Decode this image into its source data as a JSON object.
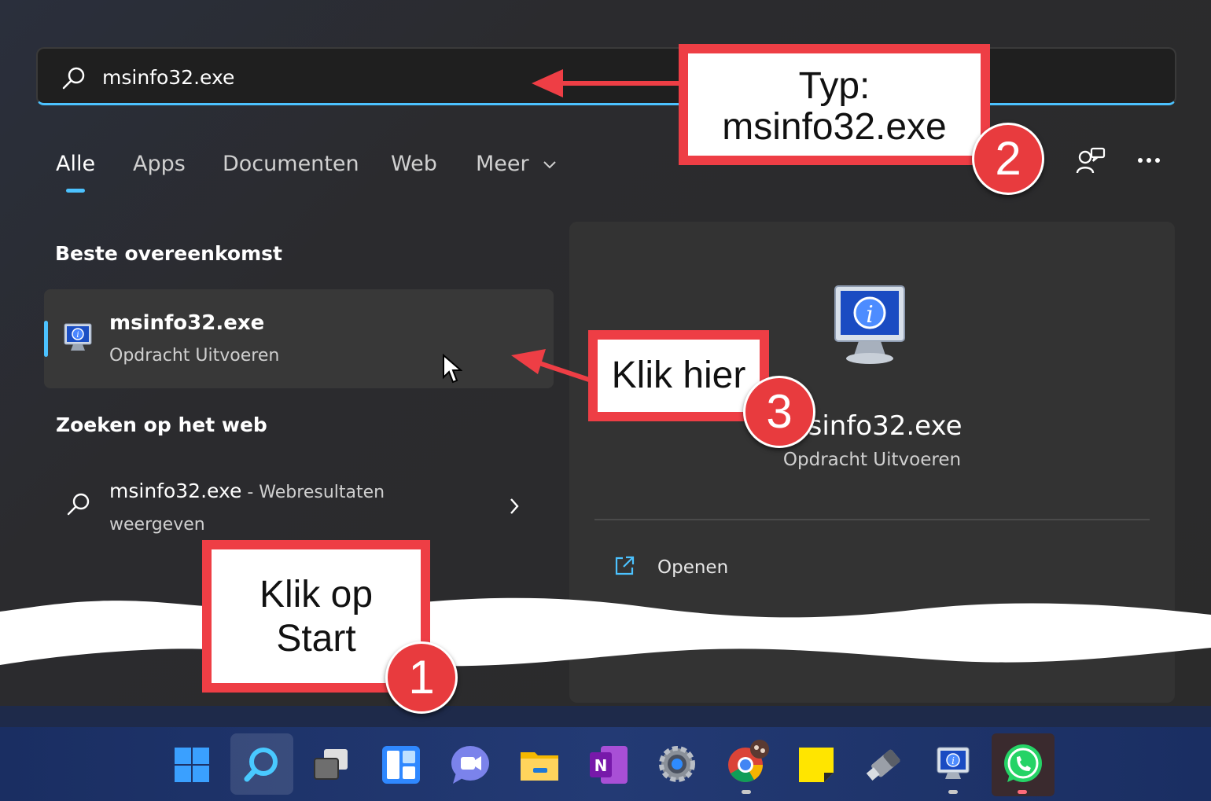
{
  "search": {
    "query": "msinfo32.exe"
  },
  "tabs": [
    {
      "label": "Alle"
    },
    {
      "label": "Apps"
    },
    {
      "label": "Documenten"
    },
    {
      "label": "Web"
    },
    {
      "label": "Meer"
    }
  ],
  "sections": {
    "best_match_title": "Beste overeenkomst",
    "web_title": "Zoeken op het web"
  },
  "best_match": {
    "name": "msinfo32.exe",
    "subtitle": "Opdracht Uitvoeren"
  },
  "web_result": {
    "name": "msinfo32.exe",
    "suffix": " - Webresultaten",
    "line2": "weergeven"
  },
  "preview": {
    "name": "msinfo32.exe",
    "subtitle": "Opdracht Uitvoeren",
    "open_label": "Openen"
  },
  "callouts": {
    "type": {
      "line1": "Typ:",
      "line2": "msinfo32.exe",
      "badge": "2"
    },
    "click_here": {
      "text": "Klik hier",
      "badge": "3"
    },
    "click_start": {
      "line1": "Klik op",
      "line2": "Start",
      "badge": "1"
    }
  },
  "colors": {
    "accent": "#4cc2ff",
    "callout_red": "#ee3e45"
  },
  "taskbar_icons": [
    "windows-start-icon",
    "search-icon",
    "task-view-icon",
    "widgets-icon",
    "teams-chat-icon",
    "file-explorer-icon",
    "onenote-icon",
    "settings-icon",
    "chrome-icon",
    "sticky-notes-icon",
    "usb-drive-icon",
    "system-information-icon",
    "whatsapp-icon"
  ]
}
